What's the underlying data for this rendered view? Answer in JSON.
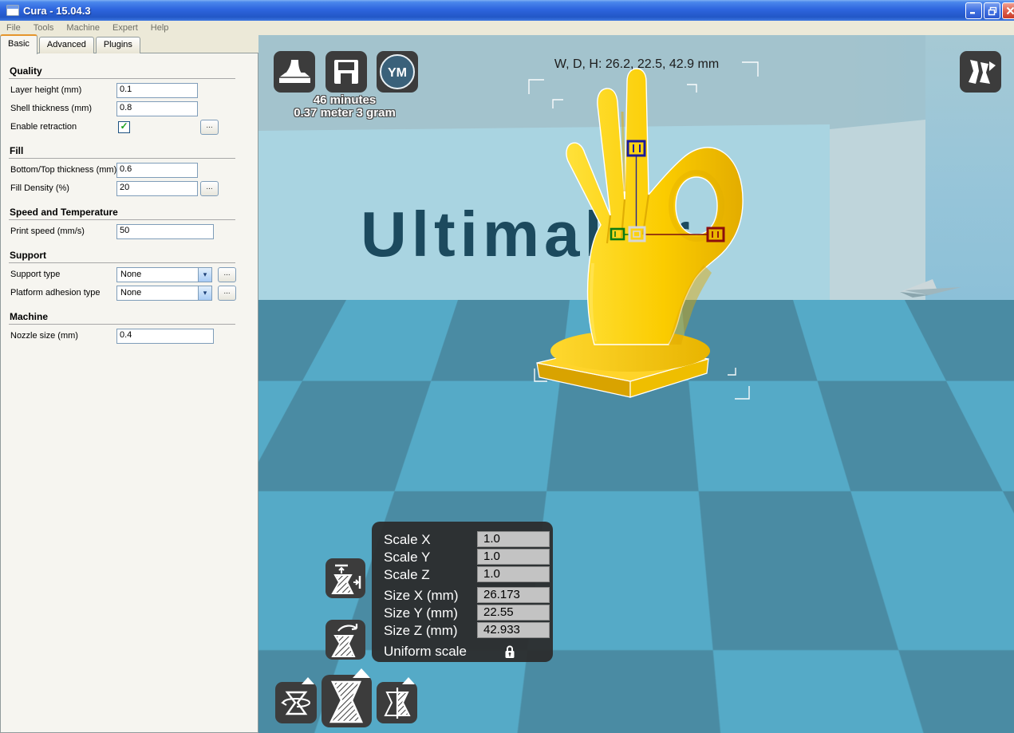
{
  "window": {
    "title": "Cura - 15.04.3",
    "controls": {
      "minimize": "minimize",
      "restore": "restore",
      "close": "close"
    }
  },
  "menu": {
    "items": [
      "File",
      "Tools",
      "Machine",
      "Expert",
      "Help"
    ]
  },
  "tabs": [
    {
      "label": "Basic",
      "active": true
    },
    {
      "label": "Advanced",
      "active": false
    },
    {
      "label": "Plugins",
      "active": false
    }
  ],
  "settings": {
    "more_label": "...",
    "sections": [
      {
        "title": "Quality",
        "rows": [
          {
            "label": "Layer height (mm)",
            "type": "input",
            "value": "0.1",
            "width": "narrow"
          },
          {
            "label": "Shell thickness (mm)",
            "type": "input",
            "value": "0.8",
            "width": "narrow"
          },
          {
            "label": "Enable retraction",
            "type": "checkbox",
            "checked": true,
            "more": true,
            "morepos": "n"
          }
        ]
      },
      {
        "title": "Fill",
        "rows": [
          {
            "label": "Bottom/Top thickness (mm)",
            "type": "input",
            "value": "0.6",
            "width": "narrow"
          },
          {
            "label": "Fill Density (%)",
            "type": "input",
            "value": "20",
            "width": "narrow",
            "more": true,
            "morepos": "n"
          }
        ]
      },
      {
        "title": "Speed and Temperature",
        "rows": [
          {
            "label": "Print speed (mm/s)",
            "type": "input",
            "value": "50",
            "width": "wide"
          }
        ]
      },
      {
        "title": "Support",
        "rows": [
          {
            "label": "Support type",
            "type": "select",
            "value": "None",
            "more": true,
            "morepos": "s"
          },
          {
            "label": "Platform adhesion type",
            "type": "select",
            "value": "None",
            "more": true,
            "morepos": "s"
          }
        ]
      },
      {
        "title": "Machine",
        "rows": [
          {
            "label": "Nozzle size (mm)",
            "type": "input",
            "value": "0.4",
            "width": "wide"
          }
        ]
      }
    ]
  },
  "viewport": {
    "toolbar": {
      "share_label": "YM"
    },
    "print_estimate": {
      "time": "46 minutes",
      "material": "0.37 meter 3 gram"
    },
    "dimensions_label": "W, D, H: 26.2, 22.5, 42.9 mm",
    "wall_logo": "Ultimaker",
    "scale_panel": {
      "rows": [
        {
          "label": "Scale X",
          "value": "1.0",
          "group": "scale"
        },
        {
          "label": "Scale Y",
          "value": "1.0",
          "group": "scale"
        },
        {
          "label": "Scale Z",
          "value": "1.0",
          "group": "scale"
        },
        {
          "label": "Size X (mm)",
          "value": "26.173",
          "group": "size"
        },
        {
          "label": "Size Y (mm)",
          "value": "22.55",
          "group": "size"
        },
        {
          "label": "Size Z (mm)",
          "value": "42.933",
          "group": "size"
        },
        {
          "label": "Uniform scale",
          "value": "",
          "group": "uniform",
          "lock": true
        }
      ]
    }
  },
  "colors": {
    "sky": "#A3C3CD",
    "wall": "#A9D4E1",
    "floor_light": "#55AAC7",
    "floor_dark": "#4A8BA3",
    "logo_navy": "#1C4A5E",
    "model_yellow": "#FFD200",
    "button_dark": "#3C3C3C",
    "ym_circle": "#3A617A",
    "titlebar_blue": "#2E65DE",
    "panel_bg": "#ECE9D8"
  }
}
